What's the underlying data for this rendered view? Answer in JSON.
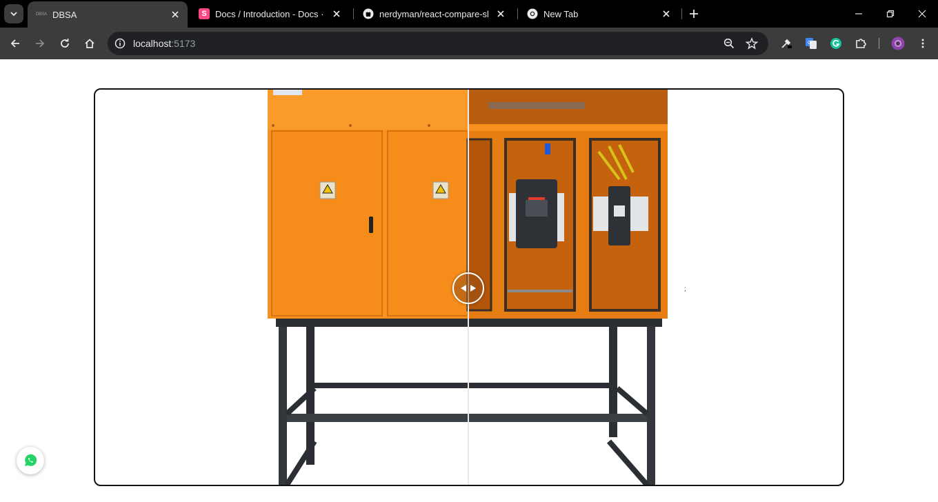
{
  "browser": {
    "tabs": [
      {
        "title": "DBSA",
        "favicon_text": "DBSA",
        "active": true
      },
      {
        "title": "Docs / Introduction - Docs · Stc",
        "favicon_text": "S",
        "active": false
      },
      {
        "title": "nerdyman/react-compare-slider",
        "favicon_text": "github-icon",
        "active": false
      },
      {
        "title": "New Tab",
        "favicon_text": "chrome-icon",
        "active": false
      }
    ],
    "url_host": "localhost",
    "url_port": ":5173",
    "accent": "#8e44ad"
  },
  "page": {
    "stray_mark": ";",
    "compare_slider": {
      "position_percent": 50,
      "left_image": "orange electrical panel, doors closed",
      "right_image": "orange electrical panel, doors open with breakers"
    },
    "whatsapp_color": "#25d366"
  }
}
